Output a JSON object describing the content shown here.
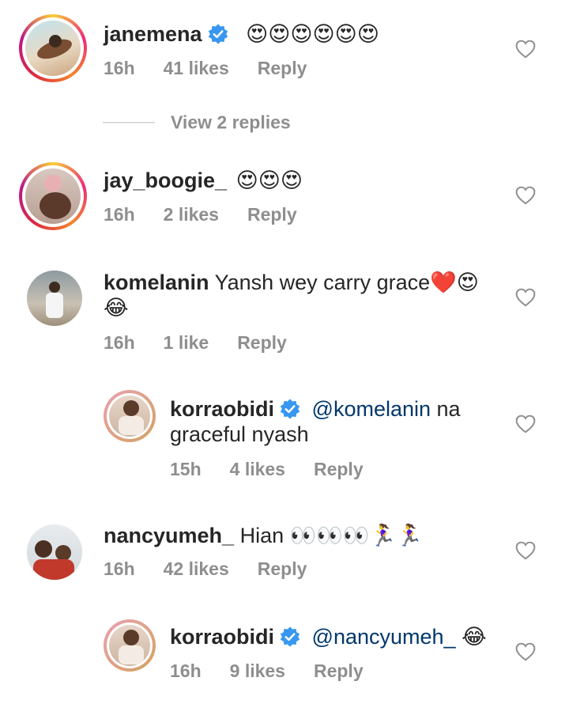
{
  "comments": [
    {
      "username": "janemena",
      "verified": true,
      "text": "",
      "emoji": "😍😍😍😍😍😍",
      "time": "16h",
      "likes": "41 likes",
      "reply": "Reply",
      "view_replies": "View 2 replies"
    },
    {
      "username": "jay_boogie_",
      "verified": false,
      "text": "",
      "emoji": "😍😍😍",
      "time": "16h",
      "likes": "2 likes",
      "reply": "Reply"
    },
    {
      "username": "komelanin",
      "verified": false,
      "text": "Yansh wey carry grace",
      "emoji": "❤️😍",
      "emoji2": "😂",
      "time": "16h",
      "likes": "1 like",
      "reply": "Reply"
    },
    {
      "username": "korraobidi",
      "verified": true,
      "mention": "@komelanin",
      "text": " na",
      "text2": "graceful nyash",
      "time": "15h",
      "likes": "4 likes",
      "reply": "Reply"
    },
    {
      "username": "nancyumeh_",
      "verified": false,
      "text": "Hian",
      "emoji": "👀👀👀🏃‍♀️🏃‍♀️",
      "time": "16h",
      "likes": "42 likes",
      "reply": "Reply"
    },
    {
      "username": "korraobidi",
      "verified": true,
      "mention": "@nancyumeh_",
      "emoji": "😂",
      "time": "16h",
      "likes": "9 likes",
      "reply": "Reply"
    }
  ],
  "colors": {
    "text": "#262626",
    "meta": "#8e8e8e",
    "mention": "#00376b",
    "verified": "#3897f0"
  },
  "icons": {
    "like": "heart-outline-icon",
    "verified": "verified-badge-icon"
  }
}
